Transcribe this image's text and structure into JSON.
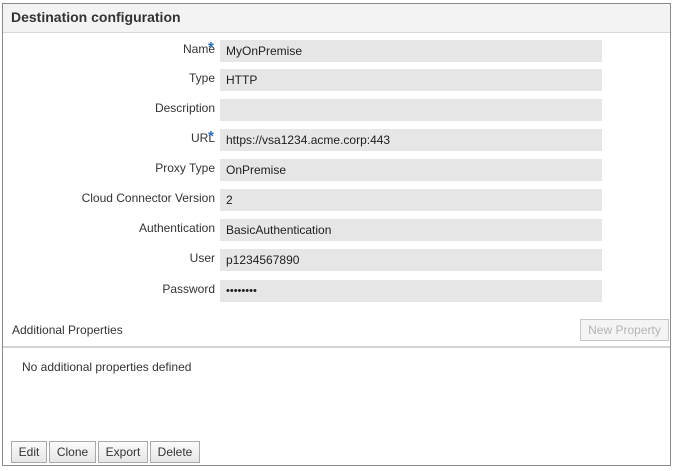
{
  "panel": {
    "title": "Destination configuration"
  },
  "form": {
    "fields": [
      {
        "label": "Name",
        "required": true,
        "value": "MyOnPremise"
      },
      {
        "label": "Type",
        "required": false,
        "value": "HTTP"
      },
      {
        "label": "Description",
        "required": false,
        "value": ""
      },
      {
        "label": "URL",
        "required": true,
        "value": "https://vsa1234.acme.corp:443"
      },
      {
        "label": "Proxy Type",
        "required": false,
        "value": "OnPremise"
      },
      {
        "label": "Cloud Connector Version",
        "required": false,
        "value": "2"
      },
      {
        "label": "Authentication",
        "required": false,
        "value": "BasicAuthentication"
      },
      {
        "label": "User",
        "required": false,
        "value": "p1234567890"
      },
      {
        "label": "Password",
        "required": false,
        "value": "••••••••"
      }
    ],
    "required_marker": "*"
  },
  "additional_properties": {
    "title": "Additional Properties",
    "new_property_label": "New Property",
    "empty_text": "No additional properties defined"
  },
  "actions": {
    "edit_label": "Edit",
    "clone_label": "Clone",
    "export_label": "Export",
    "delete_label": "Delete"
  },
  "colors": {
    "required_star": "#2a6ebd",
    "field_background": "#e6e6e6",
    "header_background": "#f3f3f3"
  }
}
